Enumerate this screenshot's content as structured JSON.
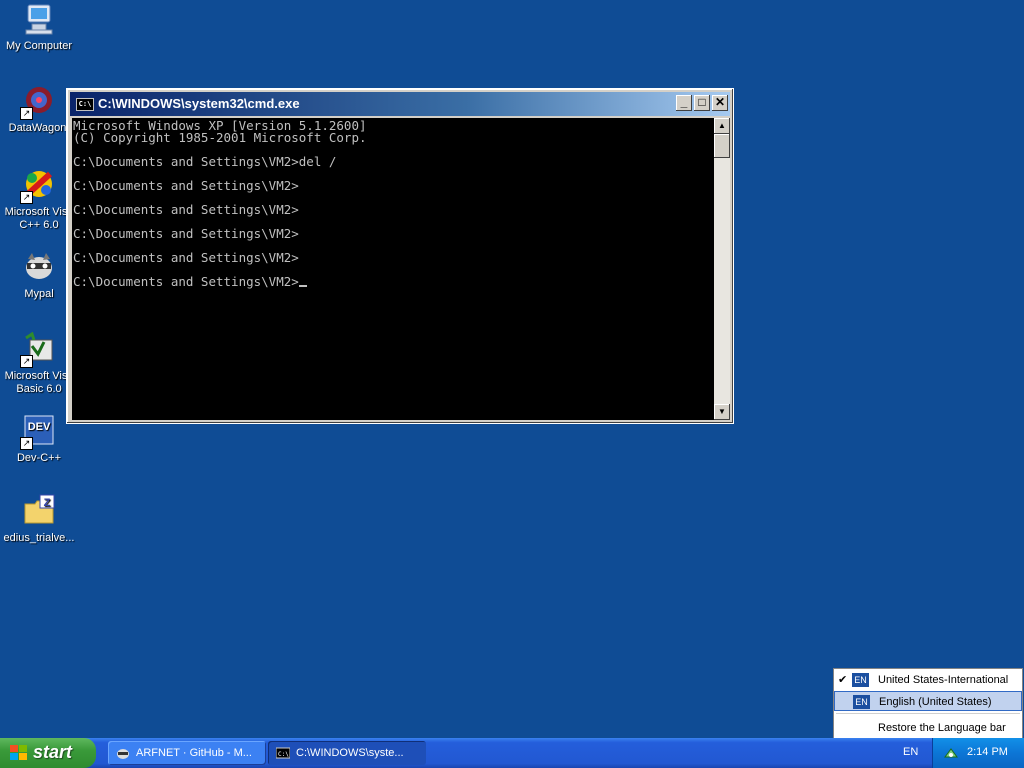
{
  "desktop": {
    "icons": [
      {
        "label": "My Computer",
        "icon": "my-computer-icon"
      },
      {
        "label": "DataWagon.",
        "icon": "datawagon-icon"
      },
      {
        "label": "Microsoft Visu\nC++ 6.0",
        "icon": "visual-cpp-icon"
      },
      {
        "label": "Mypal",
        "icon": "mypal-icon"
      },
      {
        "label": "Microsoft Visu\nBasic 6.0",
        "icon": "visual-basic-icon"
      },
      {
        "label": "Dev-C++",
        "icon": "devcpp-icon"
      },
      {
        "label": "edius_trialve...",
        "icon": "zip-folder-icon"
      }
    ]
  },
  "cmd": {
    "title": "C:\\WINDOWS\\system32\\cmd.exe",
    "icon_text": "C:\\",
    "lines": [
      "Microsoft Windows XP [Version 5.1.2600]",
      "(C) Copyright 1985-2001 Microsoft Corp.",
      "",
      "C:\\Documents and Settings\\VM2>del /",
      "",
      "C:\\Documents and Settings\\VM2>",
      "",
      "C:\\Documents and Settings\\VM2>",
      "",
      "C:\\Documents and Settings\\VM2>",
      "",
      "C:\\Documents and Settings\\VM2>",
      "",
      "C:\\Documents and Settings\\VM2>"
    ],
    "minimize": "_",
    "maximize": "□",
    "close": "✕"
  },
  "language_menu": {
    "items": [
      {
        "code": "EN",
        "label": "United States-International",
        "checked": true
      },
      {
        "code": "EN",
        "label": "English (United States)",
        "checked": false
      }
    ],
    "restore": "Restore the Language bar"
  },
  "taskbar": {
    "start": "start",
    "tasks": [
      {
        "label": "ARFNET · GitHub - M...",
        "icon": "browser-icon"
      },
      {
        "label": "C:\\WINDOWS\\syste...",
        "icon": "cmd-icon",
        "active": true
      }
    ],
    "language": "EN",
    "clock": "2:14 PM"
  },
  "colors": {
    "desktop": "#0f4c95",
    "titlebar": "#0a246a",
    "taskbar": "#245edb",
    "start": "#3a9a3a"
  }
}
